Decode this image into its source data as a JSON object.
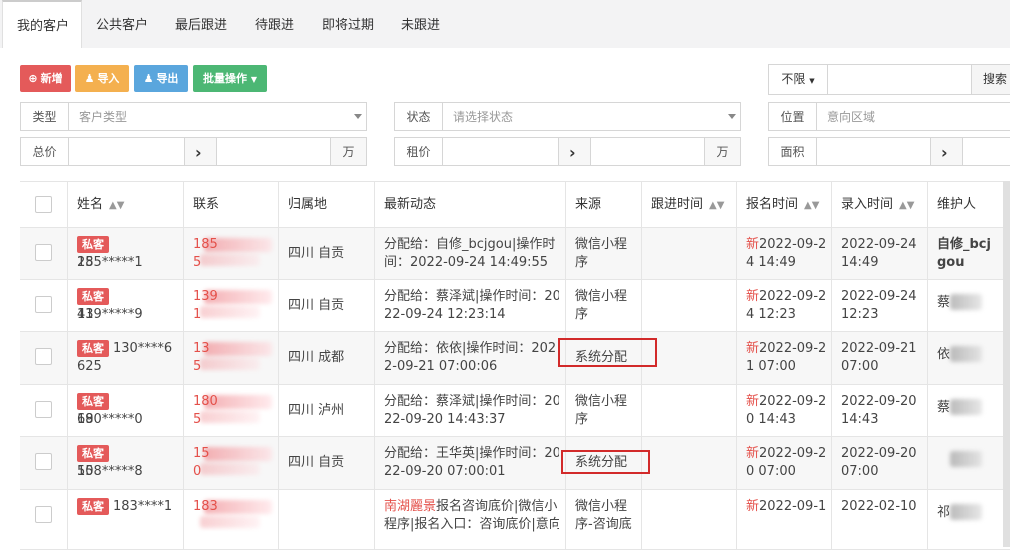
{
  "tabs": [
    "我的客户",
    "公共客户",
    "最后跟进",
    "待跟进",
    "即将过期",
    "未跟进"
  ],
  "toolbar": {
    "add": "新增",
    "import": "导入",
    "export": "导出",
    "batch": "批量操作",
    "filter_select": "不限",
    "search": "搜索"
  },
  "filters": {
    "type_label": "类型",
    "type_placeholder": "客户类型",
    "status_label": "状态",
    "status_placeholder": "请选择状态",
    "location_label": "位置",
    "location_placeholder": "意向区域",
    "total_price_label": "总价",
    "total_unit": "万",
    "rent_label": "租价",
    "rent_unit": "万",
    "area_label": "面积"
  },
  "colors": {
    "add": "#e45a5a",
    "import": "#f4b04f",
    "export": "#5aa6dd",
    "batch": "#4cb774",
    "tag": "#e45a5a",
    "highlight": "#d22a2a"
  },
  "table": {
    "headers": [
      "姓名",
      "联系",
      "归属地",
      "最新动态",
      "来源",
      "跟进时间",
      "报名时间",
      "录入时间",
      "维护人"
    ],
    "rows": [
      {
        "tag": "私客",
        "name1": "185*****1",
        "name2": "25",
        "contact1": "185",
        "contact2": "5",
        "loc": "四川 自贡",
        "act1": "分配给：自修_bcjgou|操作时",
        "act2": "间：2022-09-24 14:49:55",
        "act3": "",
        "src1": "微信小程",
        "src2": "序",
        "reg_new": "新",
        "reg1": "2022-09-2",
        "reg2": "4 14:49",
        "in1": "2022-09-24",
        "in2": "14:49",
        "m1": "自修_bcj",
        "m2": "gou"
      },
      {
        "tag": "私客",
        "name1": "139*****9",
        "name2": "41",
        "contact1": "139",
        "contact2": "1",
        "loc": "四川 自贡",
        "act1": "分配给：蔡泽斌|操作时间：20",
        "act2": "22-09-24 12:23:14",
        "act3": "",
        "src1": "微信小程",
        "src2": "序",
        "reg_new": "新",
        "reg1": "2022-09-2",
        "reg2": "4 12:23",
        "in1": "2022-09-24",
        "in2": "12:23",
        "m1": "蔡",
        "m2": ""
      },
      {
        "tag": "私客",
        "name1": "130****6",
        "name2": "625",
        "contact1": "13",
        "contact2": "5",
        "loc": "四川 成都",
        "act1": "分配给：依依|操作时间：202",
        "act2": "2-09-21 07:00:06",
        "act3": "",
        "src1": "系统分配",
        "src2": "",
        "reg_new": "新",
        "reg1": "2022-09-2",
        "reg2": "1 07:00",
        "in1": "2022-09-21",
        "in2": "07:00",
        "m1": "依",
        "m2": ""
      },
      {
        "tag": "私客",
        "name1": "180*****0",
        "name2": "69",
        "contact1": "180",
        "contact2": "5",
        "loc": "四川 泸州",
        "act1": "分配给：蔡泽斌|操作时间：20",
        "act2": "22-09-20 14:43:37",
        "act3": "",
        "src1": "微信小程",
        "src2": "序",
        "reg_new": "新",
        "reg1": "2022-09-2",
        "reg2": "0 14:43",
        "in1": "2022-09-20",
        "in2": "14:43",
        "m1": "蔡",
        "m2": ""
      },
      {
        "tag": "私客",
        "name1": "158*****8",
        "name2": "50",
        "contact1": "15",
        "contact2": "0",
        "loc": "四川 自贡",
        "act1": "分配给：王华英|操作时间：20",
        "act2": "22-09-20 07:00:01",
        "act3": "",
        "src1": "系统分配",
        "src2": "",
        "reg_new": "新",
        "reg1": "2022-09-2",
        "reg2": "0 07:00",
        "in1": "2022-09-20",
        "in2": "07:00",
        "m1": "",
        "m2": ""
      },
      {
        "tag": "私客",
        "name1": "183****1",
        "name2": "",
        "contact1": "183",
        "contact2": "",
        "loc": "",
        "act_red": "南湖麗景",
        "act1": "报名咨询底价|微信小",
        "act2": "程序|报名入口：咨询底价|意向",
        "act3": "",
        "src1": "微信小程",
        "src2": "序-咨询底",
        "reg_new": "新",
        "reg1": "2022-09-1",
        "reg2": "",
        "in1": "2022-02-10",
        "in2": "",
        "m1": "祁",
        "m2": ""
      }
    ]
  }
}
